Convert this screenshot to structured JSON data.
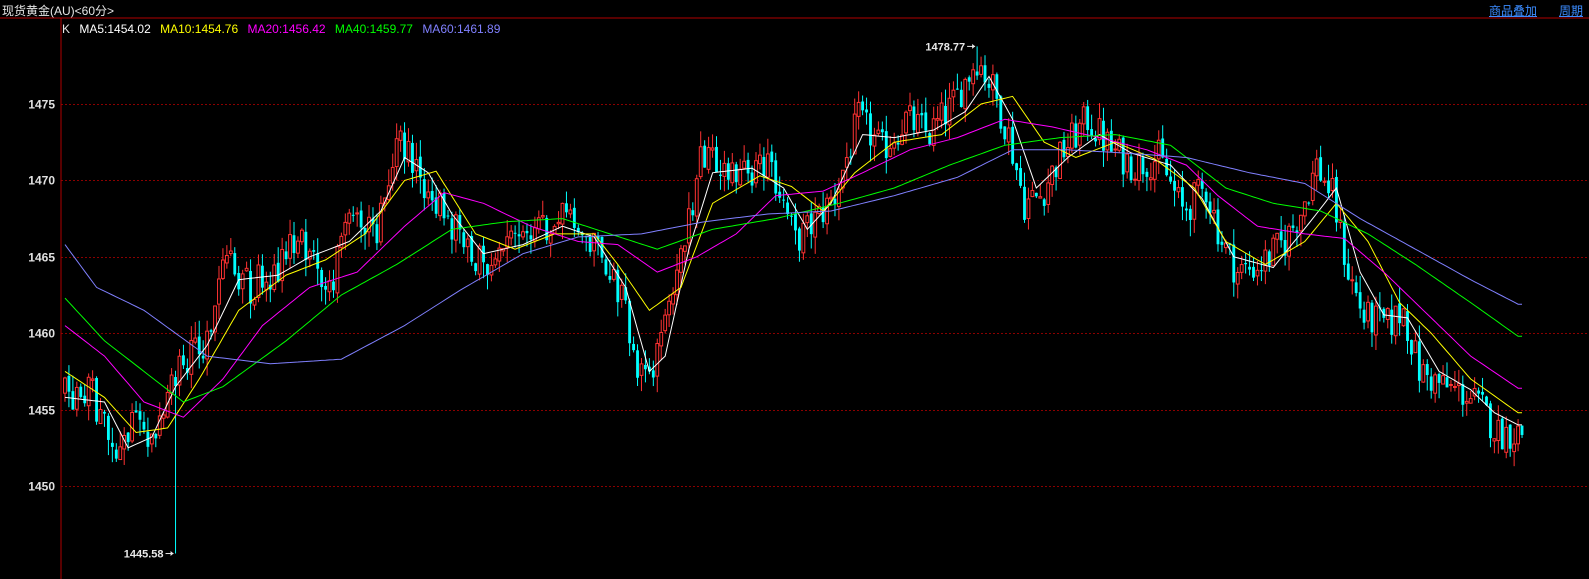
{
  "header": {
    "title": "现货黄金(AU)<60分>",
    "overlay_label": "商品叠加",
    "period_label": "周期"
  },
  "legend": {
    "k_label": "K",
    "items": [
      {
        "label": "MA5:1454.02",
        "color": "#ffffff"
      },
      {
        "label": "MA10:1454.76",
        "color": "#ffff00"
      },
      {
        "label": "MA20:1456.42",
        "color": "#ff00ff"
      },
      {
        "label": "MA40:1459.77",
        "color": "#00ff00"
      },
      {
        "label": "MA60:1461.89",
        "color": "#8080ff"
      }
    ]
  },
  "colors": {
    "up": "#ff3232",
    "down": "#00ffff",
    "grid": "#8b0000",
    "axis": "#b00000"
  },
  "chart_data": {
    "type": "candlestick",
    "ylim": [
      1443.5,
      1480.5
    ],
    "yticks": [
      1450,
      1455,
      1460,
      1465,
      1470,
      1475
    ],
    "ytick_labels": [
      "1450",
      "1455",
      "1460",
      "1465",
      "1470",
      "1475"
    ],
    "annotations": [
      {
        "text": "1478.77",
        "value": 1478.77
      },
      {
        "text": "1445.58",
        "value": 1445.58
      }
    ],
    "anchors": [
      [
        0,
        1456.0
      ],
      [
        8,
        1456.0
      ],
      [
        14,
        1451.5
      ],
      [
        18,
        1454.0
      ],
      [
        22,
        1453.0
      ],
      [
        26,
        1455.0
      ],
      [
        30,
        1458.0
      ],
      [
        36,
        1459.0
      ],
      [
        42,
        1465.0
      ],
      [
        48,
        1463.0
      ],
      [
        54,
        1464.0
      ],
      [
        60,
        1466.0
      ],
      [
        68,
        1463.0
      ],
      [
        74,
        1468.0
      ],
      [
        80,
        1467.0
      ],
      [
        86,
        1472.5
      ],
      [
        92,
        1470.0
      ],
      [
        98,
        1467.5
      ],
      [
        104,
        1465.0
      ],
      [
        110,
        1464.5
      ],
      [
        116,
        1466.0
      ],
      [
        122,
        1467.0
      ],
      [
        128,
        1467.5
      ],
      [
        134,
        1466.0
      ],
      [
        140,
        1464.0
      ],
      [
        146,
        1458.0
      ],
      [
        150,
        1457.5
      ],
      [
        154,
        1462.0
      ],
      [
        158,
        1466.0
      ],
      [
        162,
        1471.0
      ],
      [
        168,
        1471.0
      ],
      [
        174,
        1470.5
      ],
      [
        180,
        1471.0
      ],
      [
        186,
        1466.0
      ],
      [
        190,
        1467.0
      ],
      [
        196,
        1469.0
      ],
      [
        202,
        1474.0
      ],
      [
        208,
        1472.0
      ],
      [
        214,
        1474.0
      ],
      [
        220,
        1473.0
      ],
      [
        226,
        1475.0
      ],
      [
        232,
        1478.0
      ],
      [
        236,
        1476.0
      ],
      [
        240,
        1473.0
      ],
      [
        244,
        1468.5
      ],
      [
        248,
        1469.0
      ],
      [
        254,
        1472.0
      ],
      [
        260,
        1474.0
      ],
      [
        266,
        1472.0
      ],
      [
        272,
        1471.0
      ],
      [
        278,
        1471.5
      ],
      [
        284,
        1468.0
      ],
      [
        290,
        1469.5
      ],
      [
        294,
        1466.0
      ],
      [
        298,
        1464.0
      ],
      [
        304,
        1464.5
      ],
      [
        310,
        1466.0
      ],
      [
        314,
        1468.0
      ],
      [
        318,
        1471.0
      ],
      [
        322,
        1469.0
      ],
      [
        326,
        1464.0
      ],
      [
        330,
        1461.0
      ],
      [
        336,
        1460.5
      ],
      [
        340,
        1461.5
      ],
      [
        344,
        1457.5
      ],
      [
        350,
        1456.5
      ],
      [
        356,
        1456.0
      ],
      [
        360,
        1455.0
      ],
      [
        364,
        1453.5
      ],
      [
        368,
        1453.5
      ]
    ],
    "moving_averages": [
      {
        "name": "MA5",
        "color": "#ffffff",
        "values": [
          [
            0,
            1455.8
          ],
          [
            10,
            1455.5
          ],
          [
            16,
            1452.5
          ],
          [
            22,
            1453.2
          ],
          [
            28,
            1456.5
          ],
          [
            36,
            1459.2
          ],
          [
            44,
            1463.5
          ],
          [
            54,
            1463.8
          ],
          [
            62,
            1465.0
          ],
          [
            72,
            1466.0
          ],
          [
            80,
            1468.0
          ],
          [
            86,
            1471.5
          ],
          [
            92,
            1470.5
          ],
          [
            98,
            1467.8
          ],
          [
            106,
            1465.2
          ],
          [
            116,
            1465.8
          ],
          [
            126,
            1467.0
          ],
          [
            134,
            1466.3
          ],
          [
            142,
            1463.0
          ],
          [
            148,
            1457.5
          ],
          [
            152,
            1458.5
          ],
          [
            158,
            1465.5
          ],
          [
            164,
            1470.5
          ],
          [
            174,
            1470.8
          ],
          [
            182,
            1469.5
          ],
          [
            188,
            1466.8
          ],
          [
            194,
            1468.5
          ],
          [
            202,
            1473.0
          ],
          [
            210,
            1472.8
          ],
          [
            220,
            1473.3
          ],
          [
            228,
            1474.5
          ],
          [
            234,
            1476.8
          ],
          [
            240,
            1474.0
          ],
          [
            246,
            1469.5
          ],
          [
            254,
            1471.5
          ],
          [
            262,
            1473.0
          ],
          [
            270,
            1471.8
          ],
          [
            280,
            1471.0
          ],
          [
            288,
            1468.8
          ],
          [
            296,
            1465.0
          ],
          [
            306,
            1464.3
          ],
          [
            316,
            1467.5
          ],
          [
            322,
            1469.5
          ],
          [
            328,
            1464.0
          ],
          [
            334,
            1461.2
          ],
          [
            340,
            1461.0
          ],
          [
            348,
            1457.5
          ],
          [
            356,
            1456.3
          ],
          [
            362,
            1454.8
          ],
          [
            368,
            1454.0
          ]
        ]
      },
      {
        "name": "MA10",
        "color": "#ffff00",
        "values": [
          [
            0,
            1457.5
          ],
          [
            10,
            1455.8
          ],
          [
            18,
            1453.5
          ],
          [
            26,
            1453.8
          ],
          [
            34,
            1457.0
          ],
          [
            44,
            1461.5
          ],
          [
            56,
            1463.8
          ],
          [
            66,
            1464.8
          ],
          [
            76,
            1466.5
          ],
          [
            86,
            1470.0
          ],
          [
            94,
            1470.6
          ],
          [
            104,
            1466.5
          ],
          [
            114,
            1465.5
          ],
          [
            124,
            1466.5
          ],
          [
            134,
            1466.5
          ],
          [
            140,
            1464.5
          ],
          [
            148,
            1461.5
          ],
          [
            156,
            1463.0
          ],
          [
            164,
            1468.5
          ],
          [
            176,
            1470.3
          ],
          [
            184,
            1469.6
          ],
          [
            192,
            1468.0
          ],
          [
            200,
            1470.5
          ],
          [
            210,
            1472.5
          ],
          [
            222,
            1473.0
          ],
          [
            232,
            1475.0
          ],
          [
            240,
            1475.5
          ],
          [
            248,
            1472.5
          ],
          [
            256,
            1471.5
          ],
          [
            266,
            1472.5
          ],
          [
            276,
            1471.4
          ],
          [
            286,
            1469.5
          ],
          [
            294,
            1466.0
          ],
          [
            304,
            1464.5
          ],
          [
            314,
            1466.0
          ],
          [
            322,
            1468.5
          ],
          [
            330,
            1466.0
          ],
          [
            338,
            1462.0
          ],
          [
            346,
            1460.0
          ],
          [
            356,
            1457.0
          ],
          [
            368,
            1454.8
          ]
        ]
      },
      {
        "name": "MA20",
        "color": "#ff00ff",
        "values": [
          [
            0,
            1460.5
          ],
          [
            10,
            1458.5
          ],
          [
            20,
            1455.5
          ],
          [
            30,
            1454.5
          ],
          [
            40,
            1457.0
          ],
          [
            50,
            1460.5
          ],
          [
            62,
            1463.0
          ],
          [
            74,
            1464.0
          ],
          [
            86,
            1467.0
          ],
          [
            96,
            1469.2
          ],
          [
            106,
            1468.5
          ],
          [
            118,
            1467.0
          ],
          [
            130,
            1466.0
          ],
          [
            140,
            1465.8
          ],
          [
            150,
            1464.0
          ],
          [
            160,
            1465.0
          ],
          [
            170,
            1466.5
          ],
          [
            180,
            1469.0
          ],
          [
            192,
            1469.3
          ],
          [
            202,
            1470.5
          ],
          [
            214,
            1472.0
          ],
          [
            226,
            1472.8
          ],
          [
            238,
            1474.0
          ],
          [
            250,
            1473.5
          ],
          [
            262,
            1472.8
          ],
          [
            274,
            1472.0
          ],
          [
            284,
            1471.0
          ],
          [
            292,
            1469.0
          ],
          [
            302,
            1467.0
          ],
          [
            314,
            1466.5
          ],
          [
            324,
            1466.2
          ],
          [
            334,
            1464.0
          ],
          [
            344,
            1461.5
          ],
          [
            356,
            1458.5
          ],
          [
            368,
            1456.4
          ]
        ]
      },
      {
        "name": "MA40",
        "color": "#00ff00",
        "values": [
          [
            0,
            1462.3
          ],
          [
            10,
            1459.5
          ],
          [
            20,
            1457.5
          ],
          [
            30,
            1455.5
          ],
          [
            40,
            1456.5
          ],
          [
            56,
            1459.5
          ],
          [
            70,
            1462.5
          ],
          [
            84,
            1464.5
          ],
          [
            98,
            1466.8
          ],
          [
            112,
            1467.3
          ],
          [
            126,
            1467.5
          ],
          [
            138,
            1466.5
          ],
          [
            150,
            1465.5
          ],
          [
            164,
            1466.8
          ],
          [
            180,
            1467.5
          ],
          [
            196,
            1468.5
          ],
          [
            210,
            1469.5
          ],
          [
            224,
            1471.0
          ],
          [
            238,
            1472.3
          ],
          [
            252,
            1472.8
          ],
          [
            266,
            1473.0
          ],
          [
            280,
            1472.3
          ],
          [
            294,
            1469.5
          ],
          [
            306,
            1468.5
          ],
          [
            318,
            1468.0
          ],
          [
            330,
            1466.5
          ],
          [
            342,
            1464.5
          ],
          [
            356,
            1462.0
          ],
          [
            368,
            1459.8
          ]
        ]
      },
      {
        "name": "MA60",
        "color": "#8080ff",
        "values": [
          [
            0,
            1465.8
          ],
          [
            8,
            1463.0
          ],
          [
            20,
            1461.5
          ],
          [
            36,
            1458.5
          ],
          [
            52,
            1458.0
          ],
          [
            70,
            1458.3
          ],
          [
            86,
            1460.5
          ],
          [
            100,
            1462.8
          ],
          [
            116,
            1465.2
          ],
          [
            130,
            1466.3
          ],
          [
            146,
            1466.5
          ],
          [
            162,
            1467.3
          ],
          [
            178,
            1467.8
          ],
          [
            194,
            1468.0
          ],
          [
            210,
            1469.0
          ],
          [
            226,
            1470.2
          ],
          [
            240,
            1472.0
          ],
          [
            254,
            1472.0
          ],
          [
            268,
            1471.8
          ],
          [
            284,
            1471.5
          ],
          [
            300,
            1470.5
          ],
          [
            314,
            1469.8
          ],
          [
            328,
            1467.5
          ],
          [
            342,
            1465.5
          ],
          [
            356,
            1463.5
          ],
          [
            368,
            1461.9
          ]
        ]
      }
    ]
  }
}
